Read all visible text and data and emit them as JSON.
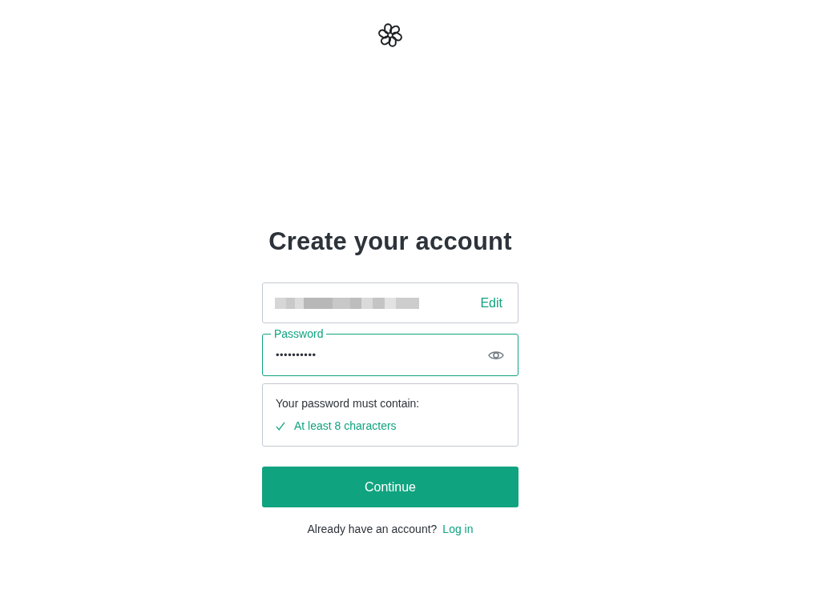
{
  "title": "Create your account",
  "email_field": {
    "focused": false,
    "action": "Edit"
  },
  "password_field": {
    "label": "Password",
    "value": "••••••••••",
    "focused": true
  },
  "requirements": {
    "heading": "Your password must contain:",
    "items": [
      {
        "text": "At least 8 characters",
        "met": true
      }
    ]
  },
  "continue_button": "Continue",
  "footer": {
    "prompt": "Already have an account?",
    "link": "Log in"
  }
}
